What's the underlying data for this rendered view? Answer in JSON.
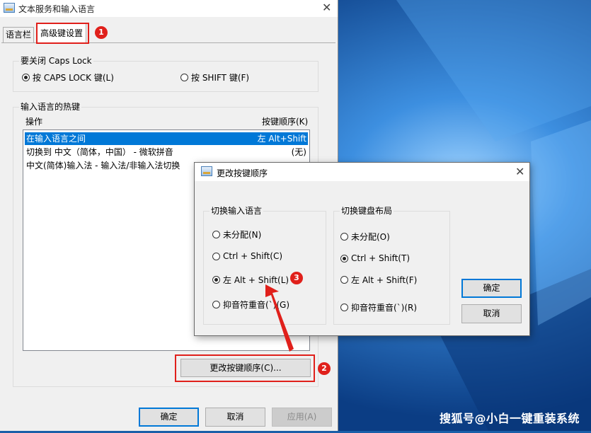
{
  "main_window": {
    "title": "文本服务和输入语言",
    "close_glyph": "✕",
    "tabs": [
      {
        "label": "语言栏"
      },
      {
        "label": "高级键设置"
      }
    ],
    "caps_group": {
      "title": "要关闭 Caps Lock",
      "options": [
        {
          "label": "按 CAPS LOCK 键(L)",
          "checked": true
        },
        {
          "label": "按 SHIFT 键(F)",
          "checked": false
        }
      ]
    },
    "hotkey_group": {
      "title": "输入语言的热键",
      "col_action": "操作",
      "col_key": "按键顺序(K)",
      "rows": [
        {
          "action": "在输入语言之间",
          "key": "左 Alt+Shift",
          "selected": true
        },
        {
          "action": "切换到 中文（简体，中国） - 微软拼音",
          "key": "(无)",
          "selected": false
        },
        {
          "action": "中文(简体)输入法 - 输入法/非输入法切换",
          "key": "",
          "selected": false
        }
      ],
      "change_button": "更改按键顺序(C)..."
    },
    "buttons": {
      "ok": "确定",
      "cancel": "取消",
      "apply": "应用(A)"
    }
  },
  "sub_dialog": {
    "title": "更改按键顺序",
    "close_glyph": "✕",
    "switch_language": {
      "title": "切换输入语言",
      "options": [
        {
          "label": "未分配(N)",
          "checked": false
        },
        {
          "label": "Ctrl + Shift(C)",
          "checked": false
        },
        {
          "label": "左 Alt + Shift(L)",
          "checked": true
        },
        {
          "label": "抑音符重音(`)(G)",
          "checked": false
        }
      ]
    },
    "switch_layout": {
      "title": "切换键盘布局",
      "options": [
        {
          "label": "未分配(O)",
          "checked": false
        },
        {
          "label": "Ctrl + Shift(T)",
          "checked": true
        },
        {
          "label": "左 Alt + Shift(F)",
          "checked": false
        },
        {
          "label": "抑音符重音(`)(R)",
          "checked": false
        }
      ]
    },
    "buttons": {
      "ok": "确定",
      "cancel": "取消"
    }
  },
  "annotations": {
    "step1": "1",
    "step2": "2",
    "step3": "3"
  },
  "watermark": "搜狐号@小白一键重装系统",
  "colors": {
    "accent": "#0078d7",
    "annotation_red": "#e0201b",
    "desktop": "#1a5fa8"
  }
}
